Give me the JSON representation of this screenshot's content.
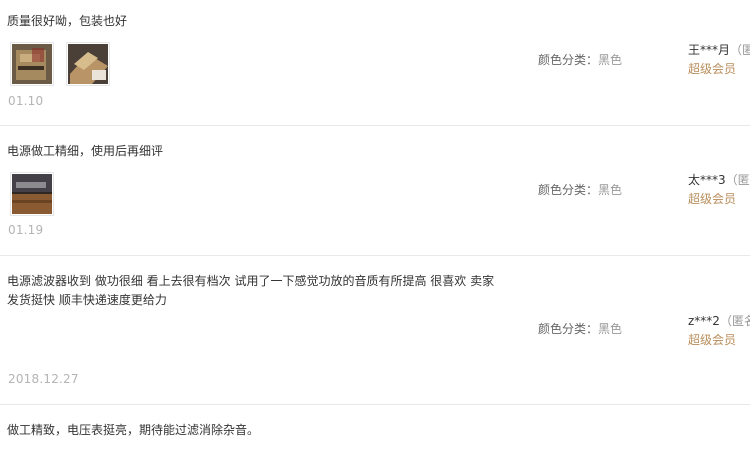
{
  "reviews": [
    {
      "text": "质量很好呦，包装也好",
      "date": "01.10",
      "attr_label": "颜色分类：",
      "attr_value": "黑色",
      "user_name": "王***月",
      "user_anon": "（匿",
      "user_level": "超级会员"
    },
    {
      "text": "电源做工精细，使用后再细评",
      "date": "01.19",
      "attr_label": "颜色分类：",
      "attr_value": "黑色",
      "user_name": "太***3",
      "user_anon": "（匿",
      "user_level": "超级会员"
    },
    {
      "text_line1": "电源滤波器收到 做功很细 看上去很有档次 试用了一下感觉功放的音质有所提高 很喜欢 卖家",
      "text_line2": "发货挺快 顺丰快递速度更给力",
      "date": "2018.12.27",
      "attr_label": "颜色分类：",
      "attr_value": "黑色",
      "user_name": "z***2",
      "user_anon": "（匿名",
      "user_level": "超级会员"
    },
    {
      "text": "做工精致，电压表挺亮，期待能过滤消除杂音。"
    }
  ]
}
